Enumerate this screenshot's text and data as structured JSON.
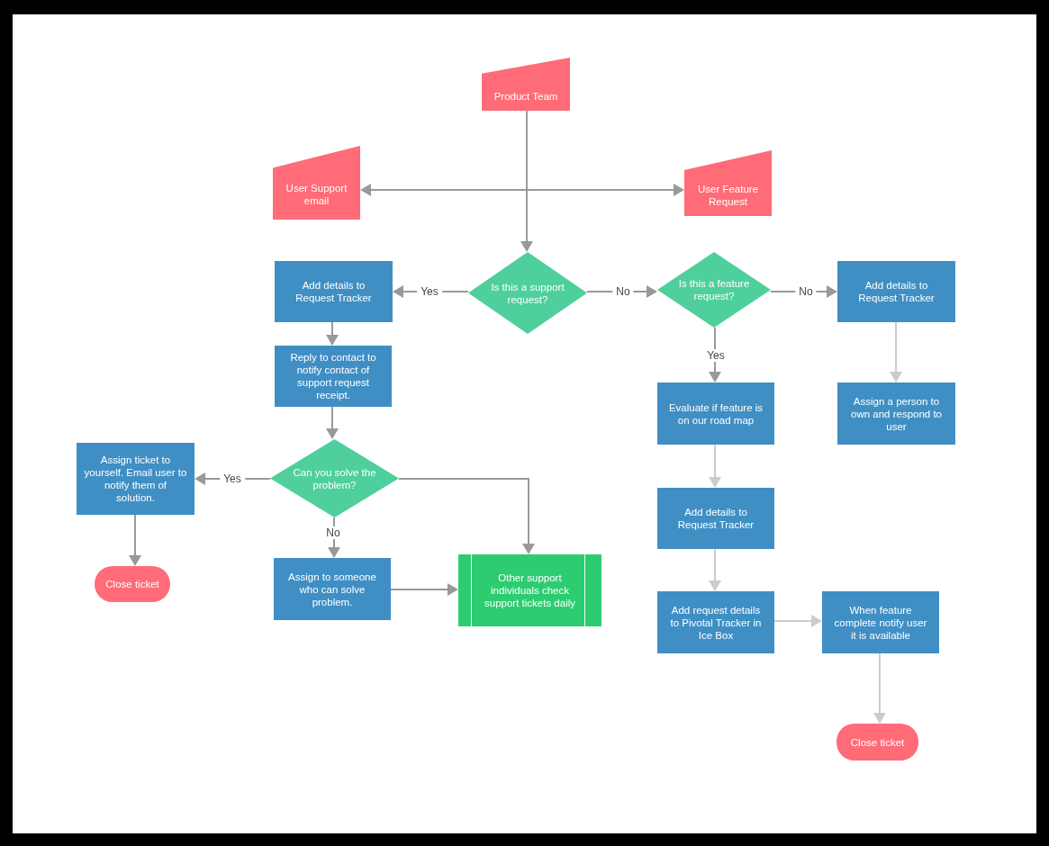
{
  "flowchart": {
    "nodes": [
      {
        "kind": "manual-input",
        "text": "Product Team"
      },
      {
        "kind": "manual-input",
        "text": "User Support\nemail"
      },
      {
        "kind": "manual-input",
        "text": "User Feature\nRequest"
      },
      {
        "kind": "process",
        "text": "Add details to\nRequest Tracker"
      },
      {
        "kind": "decision",
        "text": "Is this a support\nrequest?"
      },
      {
        "kind": "decision",
        "text": "Is this a feature\nrequest?"
      },
      {
        "kind": "process",
        "text": "Add details to\nRequest Tracker"
      },
      {
        "kind": "process",
        "text": "Reply to contact to\nnotify contact of\nsupport request\nreceipt."
      },
      {
        "kind": "process",
        "text": "Evaluate if feature is\non our road map"
      },
      {
        "kind": "process",
        "text": "Assign a person to\nown and respond to\nuser"
      },
      {
        "kind": "process",
        "text": "Assign ticket to\nyourself. Email user to\nnotify them of\nsolution."
      },
      {
        "kind": "decision",
        "text": "Can you solve the\nproblem?"
      },
      {
        "kind": "process",
        "text": "Add details to\nRequest Tracker"
      },
      {
        "kind": "terminator",
        "text": "Close ticket"
      },
      {
        "kind": "process",
        "text": "Assign to someone\nwho can solve\nproblem."
      },
      {
        "kind": "predefined-process",
        "text": "Other support\nindividuals check\nsupport tickets daily"
      },
      {
        "kind": "process",
        "text": "Add request details\nto Pivotal Tracker in\nIce Box"
      },
      {
        "kind": "process",
        "text": "When feature\ncomplete notify user\nit is available"
      },
      {
        "kind": "terminator",
        "text": "Close ticket"
      }
    ],
    "edges": [
      {
        "color": "#999999"
      },
      {
        "color": "#999999"
      },
      {
        "color": "#999999",
        "label": "Yes"
      },
      {
        "color": "#999999",
        "label": "No"
      },
      {
        "color": "#999999",
        "label": "No"
      },
      {
        "color": "#999999",
        "label": "Yes"
      },
      {
        "color": "#cccccc"
      },
      {
        "color": "#999999"
      },
      {
        "color": "#999999"
      },
      {
        "color": "#999999",
        "label": "Yes"
      },
      {
        "color": "#999999",
        "label": "No"
      },
      {
        "color": "#999999"
      },
      {
        "color": "#999999"
      },
      {
        "color": "#999999"
      },
      {
        "color": "#cccccc"
      },
      {
        "color": "#cccccc"
      },
      {
        "color": "#cccccc"
      },
      {
        "color": "#cccccc"
      }
    ]
  }
}
